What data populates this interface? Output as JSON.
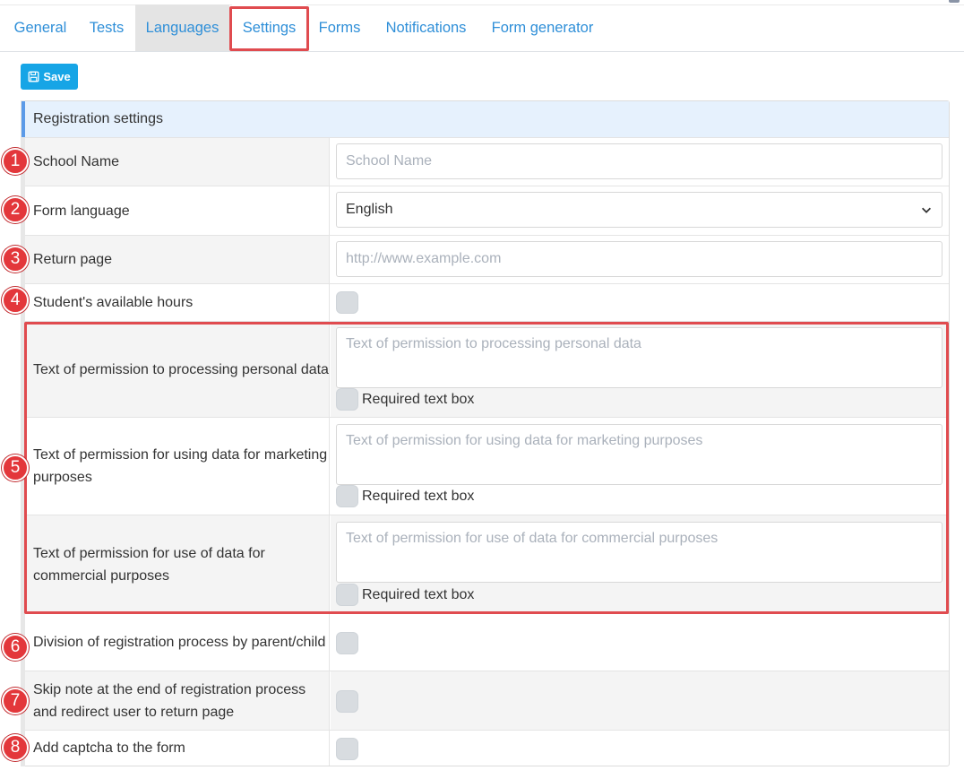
{
  "tabs": [
    {
      "label": "General"
    },
    {
      "label": "Tests"
    },
    {
      "label": "Languages"
    },
    {
      "label": "Settings"
    },
    {
      "label": "Forms"
    },
    {
      "label": "Notifications"
    },
    {
      "label": "Form generator"
    }
  ],
  "toolbar": {
    "save_label": "Save"
  },
  "panel": {
    "heading": "Registration settings"
  },
  "fields": {
    "school_name": {
      "label": "School Name",
      "placeholder": "School Name"
    },
    "form_language": {
      "label": "Form language",
      "value": "English"
    },
    "return_page": {
      "label": "Return page",
      "placeholder": "http://www.example.com"
    },
    "available_hours": {
      "label": "Student's available hours"
    },
    "permission_personal": {
      "label": "Text of permission to processing personal data",
      "placeholder": "Text of permission to processing personal data",
      "required_label": "Required text box"
    },
    "permission_marketing": {
      "label": "Text of permission for using data for marketing purposes",
      "placeholder": "Text of permission for using data for marketing purposes",
      "required_label": "Required text box"
    },
    "permission_commercial": {
      "label": "Text of permission for use of data for commercial purposes",
      "placeholder": "Text of permission for use of data for commercial purposes",
      "required_label": "Required text box"
    },
    "division": {
      "label": "Division of registration process by parent/child"
    },
    "skip_note": {
      "label": "Skip note at the end of registration process and redirect user to return page"
    },
    "captcha": {
      "label": "Add captcha to the form"
    }
  },
  "badges": [
    "1",
    "2",
    "3",
    "4",
    "5",
    "6",
    "7",
    "8"
  ],
  "colors": {
    "accent": "#16a5e6",
    "tab_link": "#2f8fd8",
    "annotation": "#e3373b",
    "heading_bg": "#e6f1fd"
  }
}
